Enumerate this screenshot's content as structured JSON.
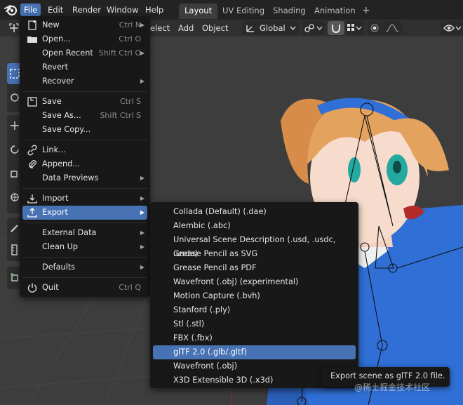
{
  "menubar": {
    "items": [
      "File",
      "Edit",
      "Render",
      "Window",
      "Help"
    ],
    "workspace_tabs": [
      "Layout",
      "UV Editing",
      "Shading",
      "Animation"
    ],
    "add_tab_symbol": "+"
  },
  "header": {
    "select_partial": "elect",
    "add_label": "Add",
    "object_label": "Object",
    "orientation_label": "Global"
  },
  "file_menu": {
    "items": [
      {
        "label": "New",
        "shortcut": "Ctrl N",
        "submenu": true,
        "icon": "new-file-icon"
      },
      {
        "label": "Open...",
        "shortcut": "Ctrl O",
        "submenu": false,
        "icon": "folder-icon"
      },
      {
        "label": "Open Recent",
        "shortcut": "Shift Ctrl O",
        "submenu": true,
        "icon": ""
      },
      {
        "label": "Revert",
        "shortcut": "",
        "submenu": false,
        "icon": ""
      },
      {
        "label": "Recover",
        "shortcut": "",
        "submenu": true,
        "icon": ""
      },
      {
        "label": "Save",
        "shortcut": "Ctrl S",
        "submenu": false,
        "icon": "save-icon"
      },
      {
        "label": "Save As...",
        "shortcut": "Shift Ctrl S",
        "submenu": false,
        "icon": ""
      },
      {
        "label": "Save Copy...",
        "shortcut": "",
        "submenu": false,
        "icon": ""
      },
      {
        "label": "Link...",
        "shortcut": "",
        "submenu": false,
        "icon": "link-icon"
      },
      {
        "label": "Append...",
        "shortcut": "",
        "submenu": false,
        "icon": "paperclip-icon"
      },
      {
        "label": "Data Previews",
        "shortcut": "",
        "submenu": true,
        "icon": ""
      },
      {
        "label": "Import",
        "shortcut": "",
        "submenu": true,
        "icon": "import-icon"
      },
      {
        "label": "Export",
        "shortcut": "",
        "submenu": true,
        "icon": "export-icon"
      },
      {
        "label": "External Data",
        "shortcut": "",
        "submenu": true,
        "icon": ""
      },
      {
        "label": "Clean Up",
        "shortcut": "",
        "submenu": true,
        "icon": ""
      },
      {
        "label": "Defaults",
        "shortcut": "",
        "submenu": true,
        "icon": ""
      },
      {
        "label": "Quit",
        "shortcut": "Ctrl Q",
        "submenu": false,
        "icon": "power-icon"
      }
    ]
  },
  "export_menu": {
    "items": [
      "Collada (Default) (.dae)",
      "Alembic (.abc)",
      "Universal Scene Description (.usd, .usdc, .usda)",
      "Grease Pencil as SVG",
      "Grease Pencil as PDF",
      "Wavefront (.obj) (experimental)",
      "Motion Capture (.bvh)",
      "Stanford (.ply)",
      "Stl (.stl)",
      "FBX (.fbx)",
      "glTF 2.0 (.glb/.gltf)",
      "Wavefront (.obj)",
      "X3D Extensible 3D (.x3d)"
    ],
    "highlighted_index": 10
  },
  "tooltip": {
    "text": "Export scene as glTF 2.0 file."
  },
  "watermark": "@稀土掘金技术社区",
  "colors": {
    "accent": "#4772b3",
    "menu_bg": "#181818",
    "topbar_bg": "#232323",
    "viewport_bg": "#3d3d3d",
    "outfit_blue": "#2f6fd6",
    "hair": "#e3a35f"
  }
}
